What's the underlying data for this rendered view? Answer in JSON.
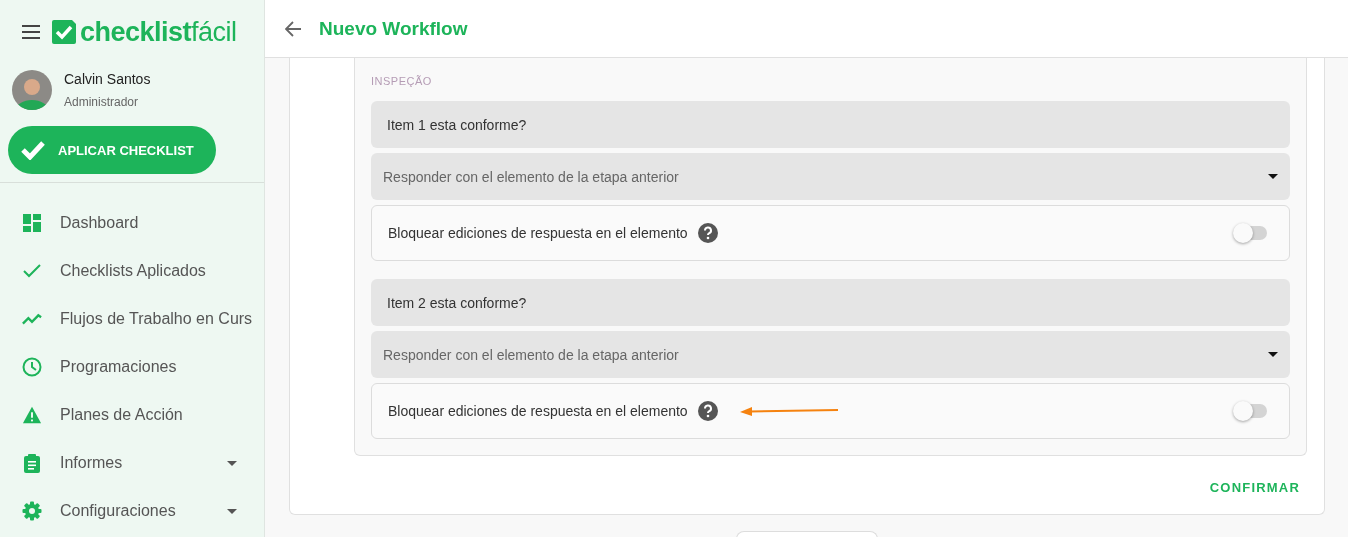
{
  "logo": {
    "main": "checklist",
    "accent": "fácil"
  },
  "user": {
    "name": "Calvin Santos",
    "role": "Administrador"
  },
  "apply_button": "APLICAR CHECKLIST",
  "menu": [
    {
      "label": "Dashboard",
      "kind": "dashboard",
      "expandable": false
    },
    {
      "label": "Checklists Aplicados",
      "kind": "check",
      "expandable": false
    },
    {
      "label": "Flujos de Trabalho en Curs",
      "kind": "trend",
      "expandable": false
    },
    {
      "label": "Programaciones",
      "kind": "clock",
      "expandable": false
    },
    {
      "label": "Planes de Acción",
      "kind": "warning",
      "expandable": false
    },
    {
      "label": "Informes",
      "kind": "clipboard",
      "expandable": true
    },
    {
      "label": "Configuraciones",
      "kind": "gear",
      "expandable": true
    }
  ],
  "header": {
    "title": "Nuevo Workflow"
  },
  "section_label": "INSPEÇÃO",
  "items": [
    {
      "question": "Item 1 esta conforme?",
      "select": "Responder con el elemento de la etapa anterior",
      "toggle_label": "Bloquear ediciones de respuesta en el elemento",
      "on": false,
      "annotated": false
    },
    {
      "question": "Item 2 esta conforme?",
      "select": "Responder con el elemento de la etapa anterior",
      "toggle_label": "Bloquear ediciones de respuesta en el elemento",
      "on": false,
      "annotated": true
    }
  ],
  "confirm_button": "CONFIRMAR"
}
